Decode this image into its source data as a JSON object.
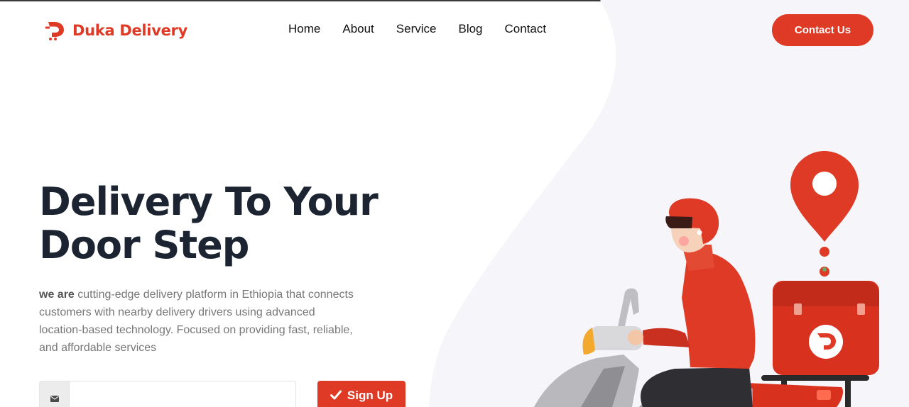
{
  "brand": {
    "name": "Duka Delivery",
    "accent_color": "#df3a26",
    "logo_icon": "delivery-d-cart-icon"
  },
  "nav": {
    "items": [
      {
        "label": "Home"
      },
      {
        "label": "About"
      },
      {
        "label": "Service"
      },
      {
        "label": "Blog"
      },
      {
        "label": "Contact"
      }
    ]
  },
  "header": {
    "contact_label": "Contact Us"
  },
  "hero": {
    "title_line1": "Delivery To Your",
    "title_line2": "Door Step",
    "desc_strong": "we are",
    "desc_rest": " cutting-edge delivery platform in Ethiopia that connects customers with nearby delivery drivers using advanced location-based technology. Focused on providing fast, reliable, and affordable services"
  },
  "signup": {
    "email_icon": "envelope-icon",
    "email_value": "",
    "email_placeholder": "",
    "button_label": "Sign Up",
    "button_icon": "check-icon"
  },
  "illustration": {
    "subject": "scooter-courier-illustration",
    "pin_icon": "location-pin-icon",
    "box_logo": "delivery-d-icon"
  }
}
